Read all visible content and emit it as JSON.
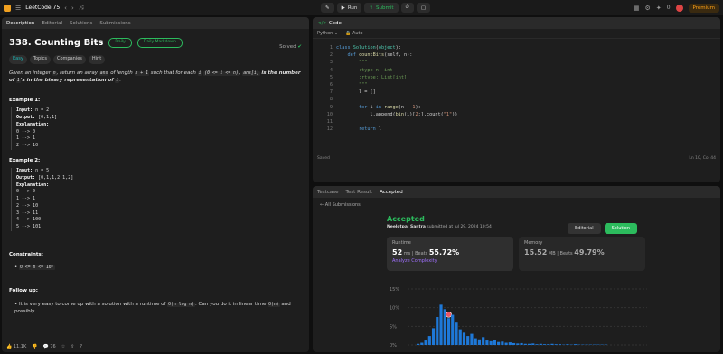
{
  "topbar": {
    "list_title": "LeetCode 75",
    "run_label": "Run",
    "submit_label": "Submit",
    "premium_label": "Premium",
    "notif_count": "0"
  },
  "left": {
    "tabs": [
      "Description",
      "Editorial",
      "Solutions",
      "Submissions"
    ],
    "title": "338. Counting Bits",
    "pill1": "Daily",
    "pill2": "Daily Markdown",
    "solved": "Solved",
    "chips": [
      "Easy",
      "Topics",
      "Companies",
      "Hint"
    ],
    "desc_1": "Given an integer",
    "desc_n": "n",
    "desc_2": ", return an array",
    "desc_ans": "ans",
    "desc_3": "of length",
    "desc_n1": "n + 1",
    "desc_4": "such that for each",
    "desc_i": "i",
    "desc_range": "(0 <= i <= n)",
    "desc_5": ",",
    "desc_ansi": "ans[i]",
    "desc_6": "is the number of",
    "desc_7": "1",
    "desc_8": "'s in the binary representation of",
    "desc_9": "i",
    "ex1_h": "Example 1:",
    "ex1_in": "Input:",
    "ex1_in_v": "n = 2",
    "ex1_out": "Output:",
    "ex1_out_v": "[0,1,1]",
    "ex1_exp": "Explanation:",
    "ex1_lines": [
      "0 --> 0",
      "1 --> 1",
      "2 --> 10"
    ],
    "ex2_h": "Example 2:",
    "ex2_in_v": "n = 5",
    "ex2_out_v": "[0,1,1,2,1,2]",
    "ex2_lines": [
      "0 --> 0",
      "1 --> 1",
      "2 --> 10",
      "3 --> 11",
      "4 --> 100",
      "5 --> 101"
    ],
    "constraints_h": "Constraints:",
    "constraint": "0 <= n <= 10⁵",
    "followup_h": "Follow up:",
    "followup_1": "It is very easy to come up with a solution with a runtime of",
    "followup_c1": "O(n log n)",
    "followup_2": ". Can you do it in linear time",
    "followup_c2": "O(n)",
    "followup_3": "and possibly",
    "likes": "11.1K",
    "comments": "76"
  },
  "code": {
    "tab": "Code",
    "lang": "Python",
    "auto": "Auto",
    "saved": "Saved",
    "cursor": "Ln 10, Col 44",
    "lines": [
      "1",
      "2",
      "3",
      "4",
      "5",
      "6",
      "7",
      "8",
      "9",
      "10",
      "11",
      "12"
    ]
  },
  "result": {
    "tabs": [
      "Testcase",
      "Test Result",
      "Accepted"
    ],
    "back": "All Submissions",
    "status": "Accepted",
    "author": "Neelotpal Santra",
    "submitted": "submitted at Jul 29, 2024 10:54",
    "editorial_btn": "Editorial",
    "solution_btn": "Solution",
    "runtime_label": "Runtime",
    "runtime_value": "52",
    "runtime_unit": "ms",
    "runtime_beats_label": "Beats",
    "runtime_beats": "55.72%",
    "analyze": "Analyze Complexity",
    "memory_label": "Memory",
    "memory_value": "15.52",
    "memory_unit": "MB",
    "memory_beats_label": "Beats",
    "memory_beats": "49.79%"
  },
  "chart_data": {
    "type": "bar",
    "yticks": [
      "15%",
      "10%",
      "5%",
      "0%"
    ],
    "ylim": [
      0,
      15
    ],
    "values": [
      0.3,
      0.6,
      1.2,
      2.4,
      4.5,
      7.5,
      10.8,
      9.6,
      7.2,
      8.1,
      6.0,
      4.2,
      3.3,
      2.4,
      3.0,
      1.8,
      1.5,
      2.1,
      1.2,
      1.0,
      1.4,
      0.8,
      0.9,
      0.6,
      0.7,
      0.5,
      0.4,
      0.5,
      0.3,
      0.3,
      0.4,
      0.2,
      0.3,
      0.2,
      0.2,
      0.3,
      0.2,
      0.2,
      0.1,
      0.2,
      0.1,
      0.2,
      0.1,
      0.1,
      0.1,
      0.1,
      0.1,
      0.1,
      0.1,
      0.1
    ],
    "highlight_index": 8,
    "color": "#1e78d7"
  }
}
